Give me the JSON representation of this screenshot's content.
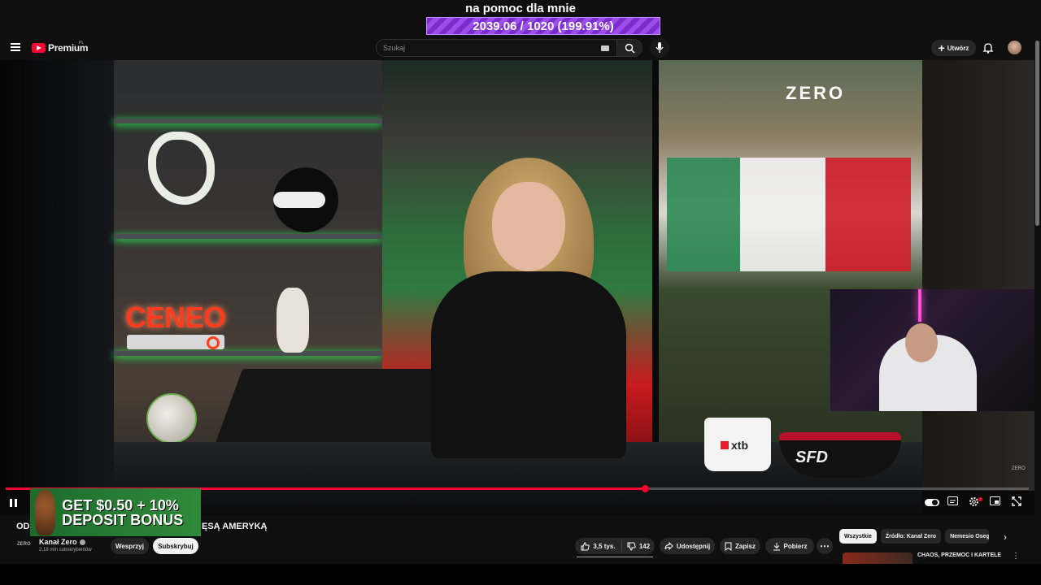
{
  "overlay": {
    "title": "na pomoc dla mnie",
    "progress_text": "2039.06 / 1020 (199.91%)"
  },
  "header": {
    "logo_text": "Premium",
    "country": "PL",
    "search_placeholder": "Szukaj",
    "create_label": "Utwórz"
  },
  "video": {
    "scene_logo": "ZERO",
    "shelf_brand": "CENEO",
    "mug_brand": "xtb",
    "bowl_brand": "SFD",
    "watermark": "ZERO",
    "progress_fraction": 0.625,
    "progress_color": "#ff0033"
  },
  "ad": {
    "text": "GET $0.50 + 10% DEPOSIT BONUS"
  },
  "details": {
    "title_prefix": "OD",
    "title_rest": "ĘSĄ AMERYKĄ",
    "channel_logo": "ZERO",
    "channel_name": "Kanał Zero",
    "subscribers": "2,18 mln subskrybentów",
    "support_label": "Wesprzyj",
    "subscribe_label": "Subskrybuj"
  },
  "actions": {
    "likes": "3,5 tys.",
    "dislikes": "142",
    "share": "Udostępnij",
    "save": "Zapisz",
    "download": "Pobierz"
  },
  "chips": [
    "Wszystkie",
    "Źródło: Kanał Zero",
    "Nemesio Oseg"
  ],
  "recommendation": {
    "title": "CHAOS, PRZEMOC I KARTELE"
  },
  "colors": {
    "accent": "#ff0033",
    "background": "#0f0f0f",
    "overlay_purple": "#9c4dea"
  }
}
